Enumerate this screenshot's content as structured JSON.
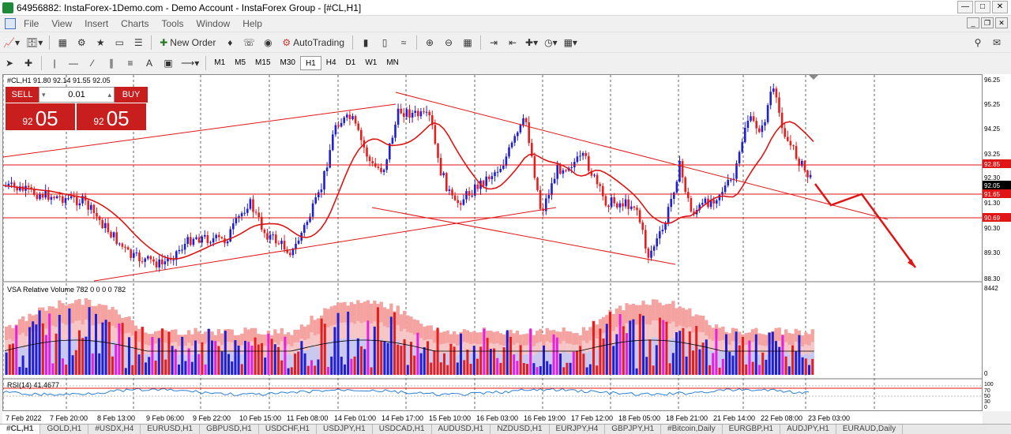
{
  "window": {
    "title": "64956882: InstaForex-1Demo.com - Demo Account - InstaForex Group - [#CL,H1]"
  },
  "menu": [
    "File",
    "View",
    "Insert",
    "Charts",
    "Tools",
    "Window",
    "Help"
  ],
  "toolbar1": {
    "new_order": "New Order",
    "autotrading": "AutoTrading"
  },
  "timeframes": [
    "M1",
    "M5",
    "M15",
    "M30",
    "H1",
    "H4",
    "D1",
    "W1",
    "MN"
  ],
  "active_timeframe": "H1",
  "chart": {
    "symbol_info": "#CL,H1  91.80 92.14 91.55 92.05",
    "one_click": {
      "sell": "SELL",
      "buy": "BUY",
      "lot": "0.01",
      "sell_small": "92",
      "sell_big": "05",
      "buy_small": "92",
      "buy_big": "05"
    },
    "price_axis": [
      "96.25",
      "95.25",
      "94.25",
      "93.25",
      "92.30",
      "91.30",
      "90.30",
      "89.30",
      "88.30"
    ],
    "price_tags": {
      "current": "92.05",
      "line1": "92.85",
      "line2": "91.65",
      "line3": "90.69"
    },
    "vsa_label": "VSA Relative Volume 782 0 0 0 0 782",
    "vsa_axis": [
      "8442",
      "0"
    ],
    "rsi_label": "RSI(14) 41.4677",
    "rsi_axis": [
      "100",
      "70",
      "50",
      "30",
      "0"
    ],
    "date_axis": [
      "7 Feb 2022",
      "7 Feb 20:00",
      "8 Feb 13:00",
      "9 Feb 06:00",
      "9 Feb 22:00",
      "10 Feb 15:00",
      "11 Feb 08:00",
      "14 Feb 01:00",
      "14 Feb 17:00",
      "15 Feb 10:00",
      "16 Feb 03:00",
      "16 Feb 19:00",
      "17 Feb 12:00",
      "18 Feb 05:00",
      "18 Feb 21:00",
      "21 Feb 14:00",
      "22 Feb 08:00",
      "23 Feb 03:00"
    ]
  },
  "tabs": [
    "#CL,H1",
    "GOLD,H1",
    "#USDX,H4",
    "EURUSD,H1",
    "GBPUSD,H1",
    "USDCHF,H1",
    "USDJPY,H1",
    "USDCAD,H1",
    "AUDUSD,H1",
    "NZDUSD,H1",
    "EURJPY,H4",
    "GBPJPY,H1",
    "#Bitcoin,Daily",
    "EURGBP,H1",
    "AUDJPY,H1",
    "EURAUD,Daily"
  ],
  "colors": {
    "bull": "#1f1fd6",
    "bear": "#e61e1e",
    "ma": "#dd1515",
    "sell": "#c81e1e"
  }
}
